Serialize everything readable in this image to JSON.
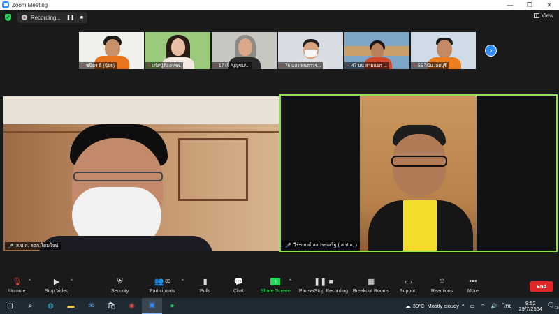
{
  "window": {
    "title": "Zoom Meeting",
    "minimize": "—",
    "maximize": "❐",
    "close": "✕"
  },
  "topbar": {
    "recording_label": "Recording...",
    "pause_glyph": "❚❚",
    "stop_glyph": "■",
    "view_label": "View"
  },
  "thumbnails": [
    {
      "name": "ชนิตร ดี (นุ้ยธ)",
      "bg": "#f0f0ec",
      "shirt": "#e8741e"
    },
    {
      "name": "เก๋ง/นู๋ต้องกทพ.",
      "bg": "#9acb7d",
      "shirt": "#f4e9e0"
    },
    {
      "name": "17 เกื้ /บุญชม/...",
      "bg": "#c8c6c0",
      "shirt": "#2a2a2a"
    },
    {
      "name": "76 แสง ทนตาวร...",
      "bg": "#d8dde4",
      "shirt": "#e0e0e0"
    },
    {
      "name": "47 นน สามแยก ...",
      "bg": "#7da6c9",
      "shirt": "#d24a2a"
    },
    {
      "name": "55 วินัน /ลตบุรี",
      "bg": "#cfdbe6",
      "shirt": "#ee7d1c"
    }
  ],
  "next_glyph": "›",
  "main_videos": {
    "left_label": "ส.ป.ก. ลอก.โดมใจน์",
    "right_label": "วีรชยนต์ ลงประเสริฐ ( ส.ป.ก. )"
  },
  "toolbar": {
    "unmute": "Unmute",
    "stop_video": "Stop Video",
    "security": "Security",
    "participants": "Participants",
    "participants_count": "88",
    "polls": "Polls",
    "chat": "Chat",
    "share_screen": "Share Screen",
    "pause_stop_recording": "Pause/Stop Recording",
    "breakout_rooms": "Breakout Rooms",
    "support": "Support",
    "reactions": "Reactions",
    "more": "More",
    "end": "End"
  },
  "taskbar": {
    "temperature": "30°C",
    "weather": "Mostly cloudy",
    "language": "ไทย",
    "time": "8:52",
    "date": "29/7/2564",
    "notifications": "10"
  },
  "colors": {
    "accent_blue": "#2d8cff",
    "active_speaker_border": "#8ee44c",
    "end_red": "#e02828",
    "share_green": "#23d959"
  }
}
